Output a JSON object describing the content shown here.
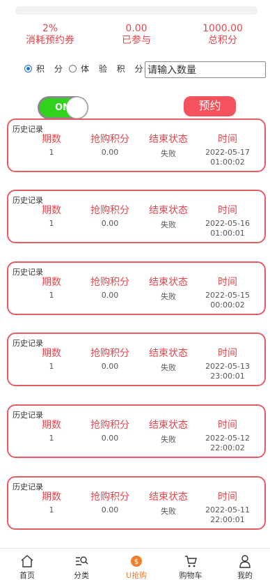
{
  "stats": [
    {
      "value": "2%",
      "label": "消耗预约券"
    },
    {
      "value": "0.00",
      "label": "已参与"
    },
    {
      "value": "1000.00",
      "label": "总积分"
    }
  ],
  "options": {
    "points_label": "积 分",
    "trial_points_label": "体 验 积 分",
    "selected": "points"
  },
  "quantity": {
    "placeholder": "请输入数量"
  },
  "toggle": {
    "label": "ON"
  },
  "reserve_button": "预约",
  "history": {
    "title": "历史记录",
    "headers": [
      "期数",
      "抢购积分",
      "结束状态",
      "时间"
    ],
    "records": [
      {
        "period": "1",
        "points": "0.00",
        "status": "失败",
        "date": "2022-05-17",
        "time": "01:00:02"
      },
      {
        "period": "1",
        "points": "0.00",
        "status": "失败",
        "date": "2022-05-16",
        "time": "01:00:01"
      },
      {
        "period": "1",
        "points": "0.00",
        "status": "失败",
        "date": "2022-05-15",
        "time": "00:00:02"
      },
      {
        "period": "1",
        "points": "0.00",
        "status": "失败",
        "date": "2022-05-13",
        "time": "23:00:01"
      },
      {
        "period": "1",
        "points": "0.00",
        "status": "失败",
        "date": "2022-05-12",
        "time": "22:00:02"
      },
      {
        "period": "1",
        "points": "0.00",
        "status": "失败",
        "date": "2022-05-11",
        "time": "22:00:01"
      }
    ]
  },
  "nav": [
    {
      "label": "首页",
      "icon": "home-icon"
    },
    {
      "label": "分类",
      "icon": "category-search-icon"
    },
    {
      "label": "U抢购",
      "icon": "coin-icon",
      "active": true
    },
    {
      "label": "购物车",
      "icon": "cart-icon"
    },
    {
      "label": "我的",
      "icon": "user-icon"
    }
  ],
  "colors": {
    "accent": "#e2474d",
    "button": "#f4525d",
    "toggle_on": "#2ed31a",
    "nav_active": "#ef7d2a"
  }
}
